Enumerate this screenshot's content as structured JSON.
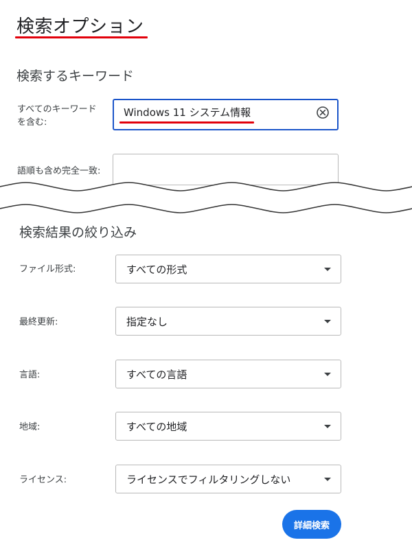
{
  "page_title": "検索オプション",
  "keywords_section": {
    "heading": "検索するキーワード",
    "all_words": {
      "label_line1": "すべてのキーワード",
      "label_line2": "を含む:",
      "value": "Windows 11 システム情報"
    },
    "exact_phrase": {
      "label": "語順も含め完全一致:",
      "value": ""
    }
  },
  "filter_section": {
    "heading": "検索結果の絞り込み",
    "filters": [
      {
        "label": "ファイル形式:",
        "value": "すべての形式"
      },
      {
        "label": "最終更新:",
        "value": "指定なし"
      },
      {
        "label": "言語:",
        "value": "すべての言語"
      },
      {
        "label": "地域:",
        "value": "すべての地域"
      },
      {
        "label": "ライセンス:",
        "value": "ライセンスでフィルタリングしない"
      }
    ]
  },
  "submit_label": "詳細検索",
  "colors": {
    "accent_blue": "#1a73e8",
    "focus_border": "#1a54c9",
    "annotation_red": "#e2000a"
  },
  "icons": {
    "clear": "clear-circle-x-icon",
    "dropdown": "chevron-down-icon"
  }
}
